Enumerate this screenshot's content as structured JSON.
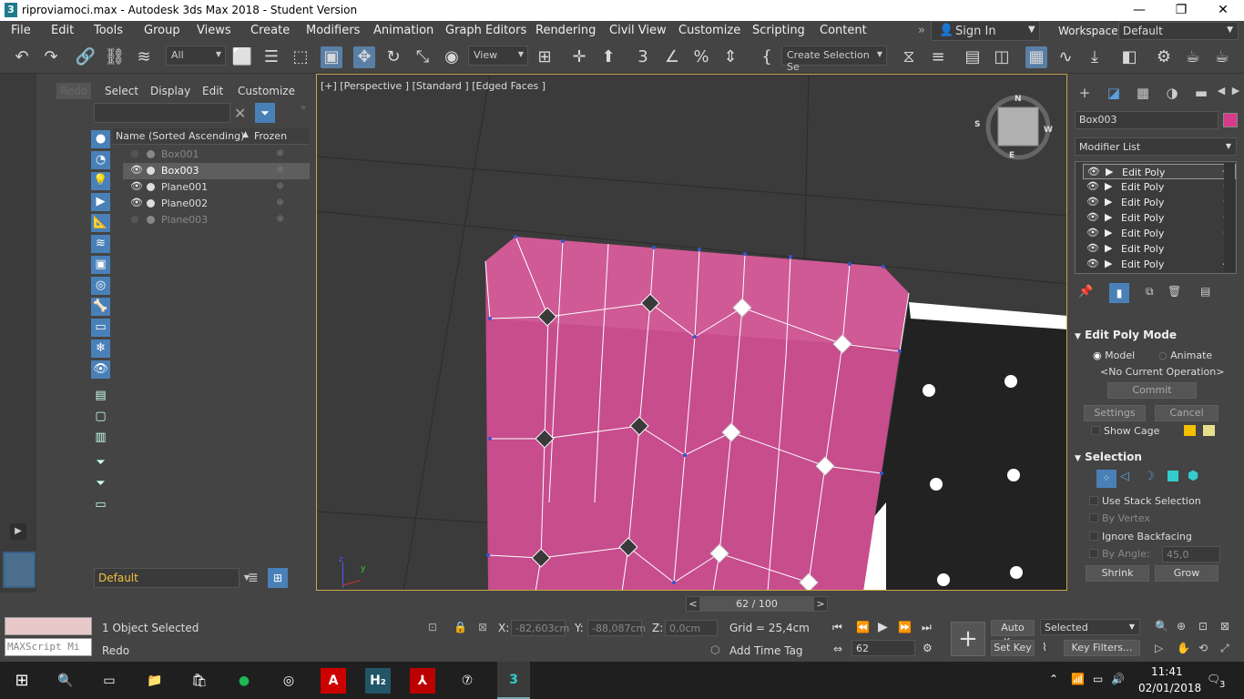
{
  "titlebar": {
    "title": "riproviamoci.max - Autodesk 3ds Max 2018 - Student Version",
    "app_icon": "3",
    "minimize": "—",
    "maximize": "❐",
    "close": "✕"
  },
  "menu": [
    "File",
    "Edit",
    "Tools",
    "Group",
    "Views",
    "Create",
    "Modifiers",
    "Animation",
    "Graph Editors",
    "Rendering",
    "Civil View",
    "Customize",
    "Scripting",
    "Content"
  ],
  "signin": "Sign In",
  "workspaces_label": "Workspaces:",
  "workspace": "Default",
  "toolbar": {
    "filter": "All",
    "refcoord": "View",
    "selset": "Create Selection Se"
  },
  "scene": {
    "redo": "Redo",
    "tabs": [
      "Select",
      "Display",
      "Edit",
      "Customize"
    ],
    "col_name": "Name (Sorted Ascending)",
    "col_frozen": "Frozen",
    "sort_arrow": "▲",
    "rows": [
      {
        "name": "Box001",
        "visible": false
      },
      {
        "name": "Box003",
        "visible": true,
        "selected": true
      },
      {
        "name": "Plane001",
        "visible": true
      },
      {
        "name": "Plane002",
        "visible": true
      },
      {
        "name": "Plane003",
        "visible": false
      }
    ],
    "layer": "Default"
  },
  "viewport": {
    "label": "[+] [Perspective ] [Standard ] [Edged Faces ]",
    "axis_z": "z",
    "axis_x": "x",
    "axis_y": "y"
  },
  "cmd": {
    "object_name": "Box003",
    "object_color": "#d63a8a",
    "modifier_list": "Modifier List",
    "stack": [
      "Edit Poly",
      "Edit Poly",
      "Edit Poly",
      "Edit Poly",
      "Edit Poly",
      "Edit Poly",
      "Edit Poly"
    ],
    "editpoly_mode": "Edit Poly Mode",
    "model": "Model",
    "animate": "Animate",
    "no_op": "<No Current Operation>",
    "commit": "Commit",
    "settings": "Settings",
    "cancel": "Cancel",
    "show_cage": "Show Cage",
    "selection": "Selection",
    "use_stack": "Use Stack Selection",
    "by_vertex": "By Vertex",
    "ignore_back": "Ignore Backfacing",
    "by_angle": "By Angle:",
    "angle_val": "45,0",
    "shrink": "Shrink",
    "grow": "Grow"
  },
  "timeline": {
    "frame": "62 / 100",
    "prev": "<",
    "next": ">"
  },
  "status": {
    "selected": "1 Object Selected",
    "prompt": "Redo",
    "maxscript": "MAXScript Mi",
    "x_label": "X:",
    "x": "-82,603cm",
    "y_label": "Y:",
    "y": "-88,087cm",
    "z_label": "Z:",
    "z": "0,0cm",
    "grid": "Grid = 25,4cm",
    "add_time_tag": "Add Time Tag",
    "autokey": "Auto Key",
    "setkey": "Set Key",
    "sel_mode": "Selected",
    "key_filters": "Key Filters...",
    "frame_field": "62"
  },
  "taskbar": {
    "time": "11:41",
    "date": "02/01/2018",
    "notif": "3"
  }
}
